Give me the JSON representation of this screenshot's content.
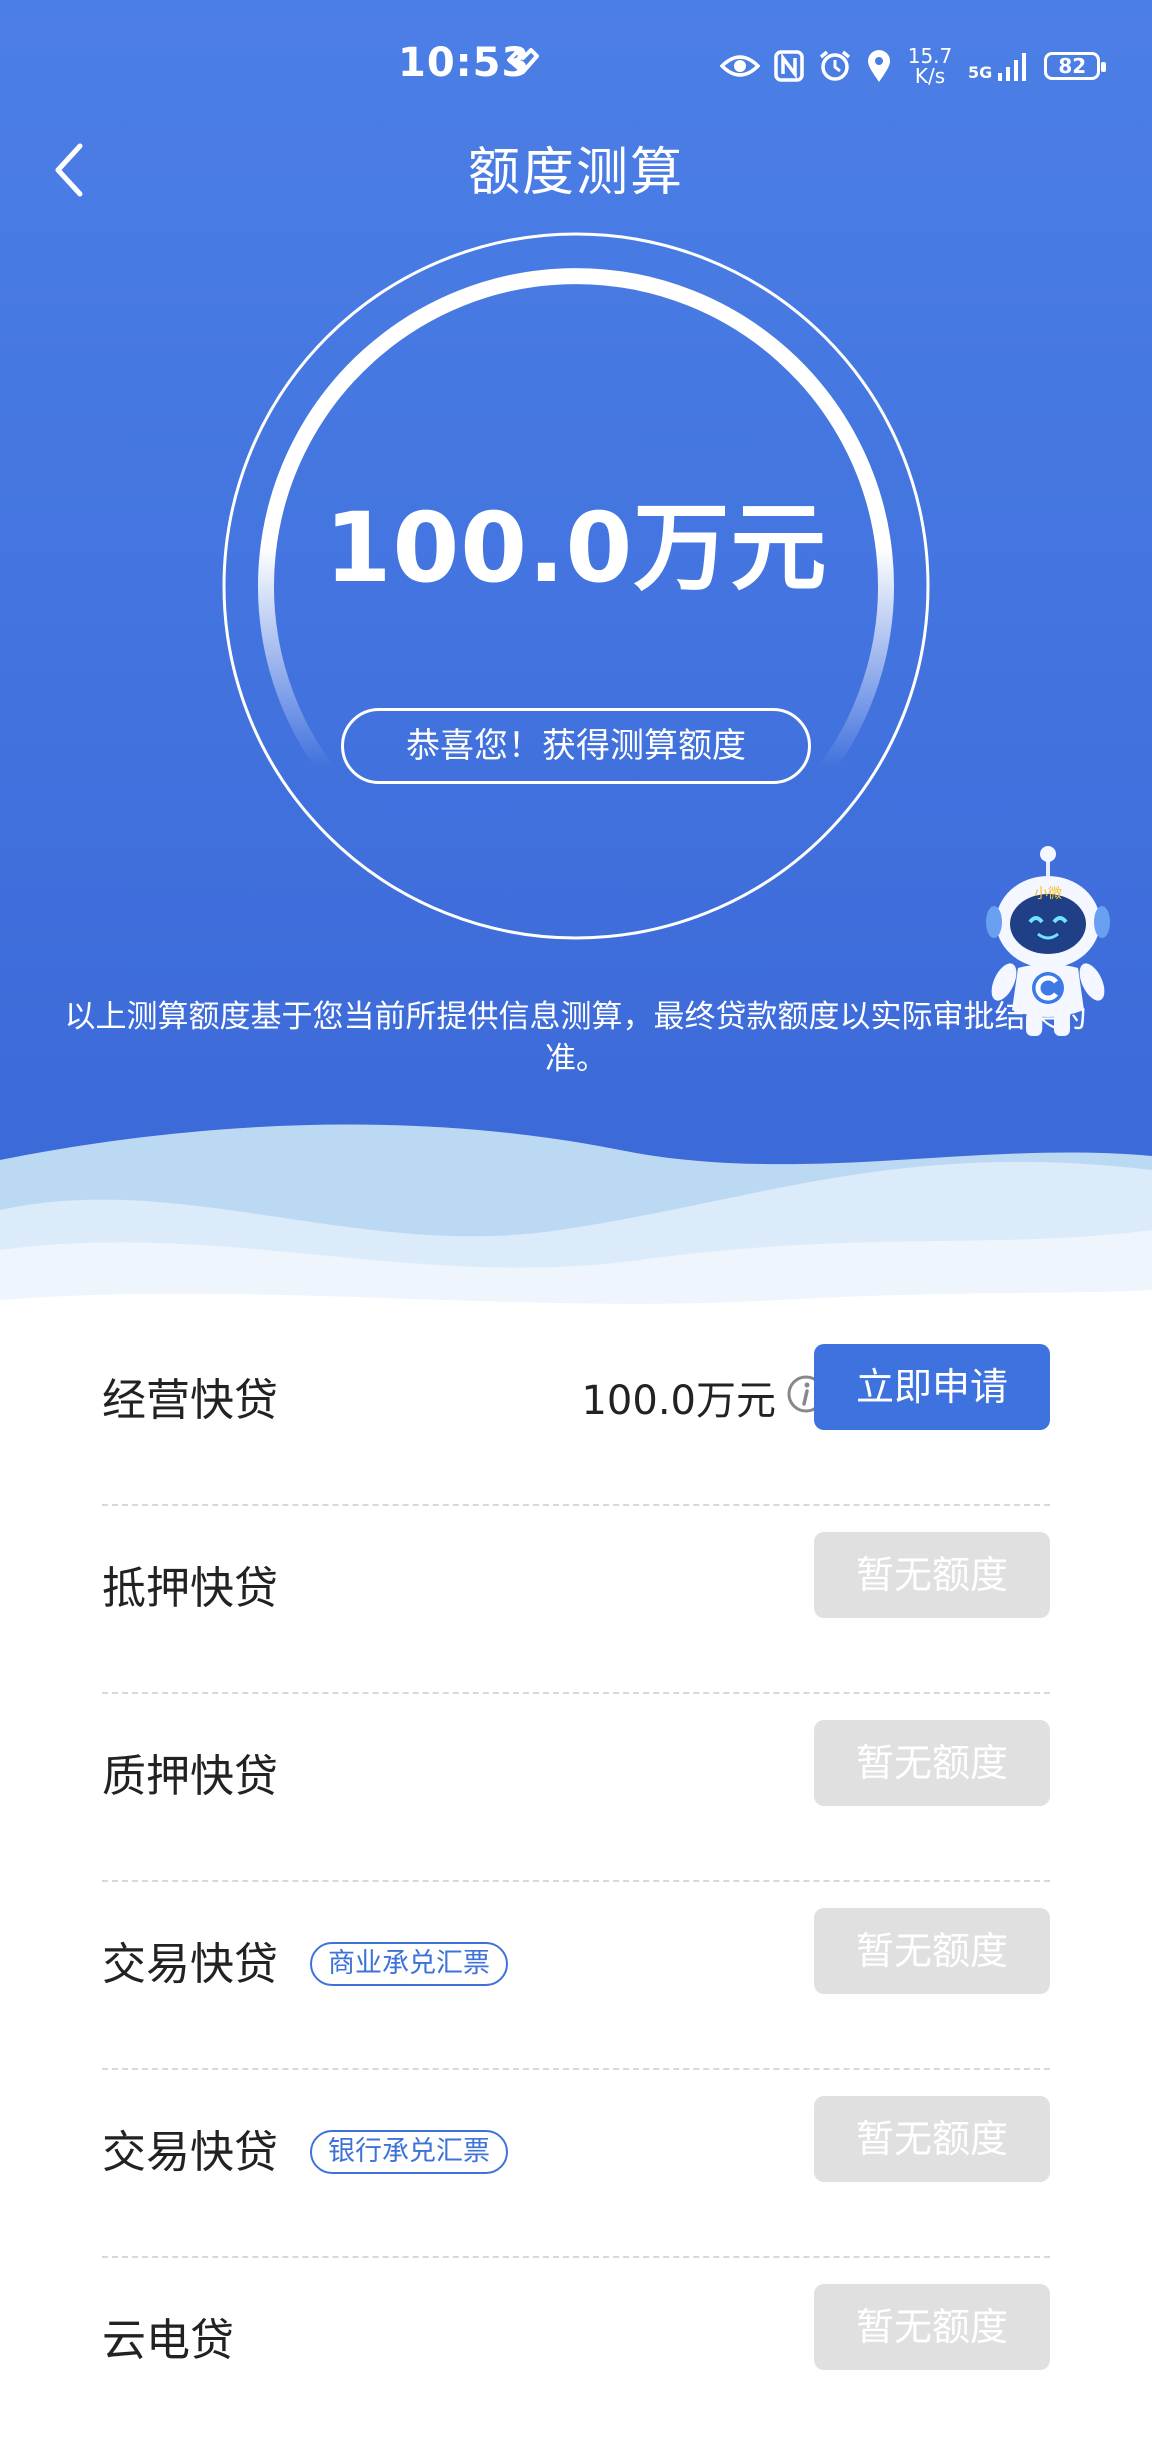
{
  "status_bar": {
    "time": "10:53",
    "net_speed_value": "15.7",
    "net_speed_unit": "K/s",
    "network": "5G",
    "battery": "82",
    "icons": [
      "eye-icon",
      "nfc-icon",
      "alarm-icon",
      "location-icon",
      "signal-icon",
      "battery-icon"
    ]
  },
  "header": {
    "title": "额度测算",
    "back_icon": "chevron-left-icon"
  },
  "result": {
    "amount": "100.0万元",
    "congrats": "恭喜您！获得测算额度",
    "notice": "以上测算额度基于您当前所提供信息测算，最终贷款额度以实际审批结果为准。"
  },
  "products": [
    {
      "name": "经营快贷",
      "amount": "100.0万元",
      "action": "立即申请",
      "available": true
    },
    {
      "name": "抵押快贷",
      "action": "暂无额度",
      "available": false
    },
    {
      "name": "质押快贷",
      "action": "暂无额度",
      "available": false
    },
    {
      "name": "交易快贷",
      "tag": "商业承兑汇票",
      "action": "暂无额度",
      "available": false
    },
    {
      "name": "交易快贷",
      "tag": "银行承兑汇票",
      "action": "暂无额度",
      "available": false
    },
    {
      "name": "云电贷",
      "action": "暂无额度",
      "available": false
    }
  ],
  "robot_badge": "小微",
  "colors": {
    "primary": "#3e72df",
    "hero_top": "#4c7fe6",
    "hero_bottom": "#3a67d7",
    "disabled": "#e0e0e0"
  }
}
